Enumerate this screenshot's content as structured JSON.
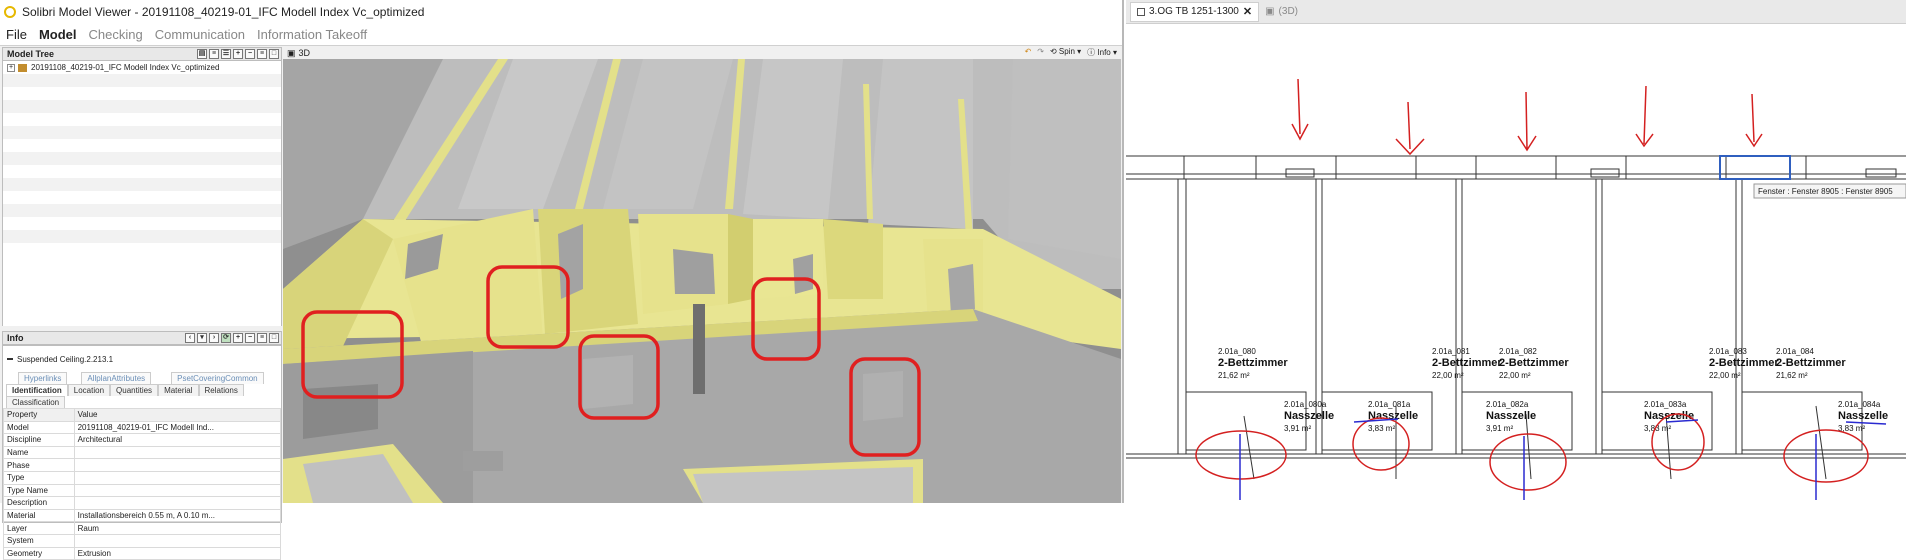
{
  "window": {
    "title": "Solibri Model Viewer - 20191108_40219-01_IFC Modell Index Vc_optimized"
  },
  "menu": [
    "File",
    "Model",
    "Checking",
    "Communication",
    "Information Takeoff"
  ],
  "model_tree": {
    "title": "Model Tree",
    "items": [
      "20191108_40219-01_IFC Modell Index Vc_optimized"
    ]
  },
  "info_panel": {
    "title": "Info",
    "selected": "Suspended Ceiling.2.213.1",
    "tabs_row1": [
      "Hyperlinks",
      "AllplanAttributes",
      "PsetCoveringCommon"
    ],
    "tabs_row2": [
      "Identification",
      "Location",
      "Quantities",
      "Material",
      "Relations",
      "Classification"
    ],
    "active_tab": "Identification",
    "columns": [
      "Property",
      "Value"
    ],
    "rows": [
      [
        "Model",
        "20191108_40219-01_IFC Modell Ind..."
      ],
      [
        "Discipline",
        "Architectural"
      ],
      [
        "Name",
        ""
      ],
      [
        "Phase",
        ""
      ],
      [
        "Type",
        ""
      ],
      [
        "Type Name",
        ""
      ],
      [
        "Description",
        ""
      ],
      [
        "Material",
        "Installationsbereich 0.55 m, A 0.10 m..."
      ],
      [
        "Layer",
        "Raum"
      ],
      [
        "System",
        ""
      ],
      [
        "Geometry",
        "Extrusion"
      ]
    ]
  },
  "view3d": {
    "title": "3D",
    "spin_label": "Spin",
    "info_label": "Info",
    "colors": {
      "wall": "#c8c8c8",
      "yellow": "#e3e08a",
      "highlight": "#e02020"
    }
  },
  "drawing": {
    "tabs": [
      {
        "label": "3.OG TB 1251-1300",
        "active": true
      },
      {
        "label": "(3D)",
        "active": false
      }
    ],
    "tooltip": "Fenster : Fenster 8905 : Fenster 8905",
    "rooms": [
      {
        "id": "2.01a_080",
        "name": "2-Bettzimmer",
        "area": "21,62 m²"
      },
      {
        "id": "2.01a_081",
        "name": "2-Bettzimmer",
        "area": "22,00 m²"
      },
      {
        "id": "2.01a_082",
        "name": "2-Bettzimmer",
        "area": "22,00 m²"
      },
      {
        "id": "2.01a_083",
        "name": "2-Bettzimmer",
        "area": "22,00 m²"
      },
      {
        "id": "2.01a_084",
        "name": "2-Bettzimmer",
        "area": "21,62 m²"
      }
    ],
    "wetrooms": [
      {
        "id": "2.01a_080a",
        "name": "Nasszelle",
        "area": "3,91 m²"
      },
      {
        "id": "2.01a_081a",
        "name": "Nasszelle",
        "area": "3,83 m²"
      },
      {
        "id": "2.01a_082a",
        "name": "Nasszelle",
        "area": "3,91 m²"
      },
      {
        "id": "2.01a_083a",
        "name": "Nasszelle",
        "area": "3,83 m²"
      },
      {
        "id": "2.01a_084a",
        "name": "Nasszelle",
        "area": "3,83 m²"
      }
    ]
  }
}
